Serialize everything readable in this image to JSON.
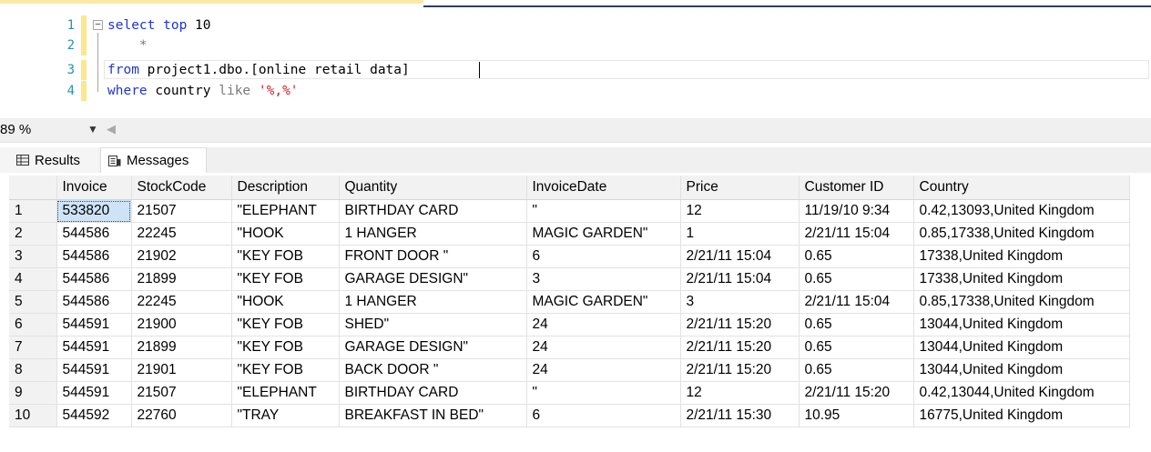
{
  "editor": {
    "lines": [
      {
        "number": "1",
        "segments": [
          {
            "text": "select top",
            "cls": "kw"
          },
          {
            "text": " 10",
            "cls": ""
          }
        ]
      },
      {
        "number": "2",
        "segments": [
          {
            "text": "    *",
            "cls": "gray"
          }
        ]
      },
      {
        "number": "3",
        "segments": [
          {
            "text": "from",
            "cls": "kw"
          },
          {
            "text": " project1.dbo.[online retail data]",
            "cls": ""
          }
        ]
      },
      {
        "number": "4",
        "segments": [
          {
            "text": "where",
            "cls": "kw"
          },
          {
            "text": " country ",
            "cls": ""
          },
          {
            "text": "like",
            "cls": "gray"
          },
          {
            "text": " ",
            "cls": ""
          },
          {
            "text": "'%,%'",
            "cls": "str"
          }
        ]
      }
    ]
  },
  "zoom": {
    "value": "89 %"
  },
  "tabs": {
    "results": "Results",
    "messages": "Messages"
  },
  "grid": {
    "columns": [
      "",
      "Invoice",
      "StockCode",
      "Description",
      "Quantity",
      "InvoiceDate",
      "Price",
      "Customer ID",
      "Country"
    ],
    "rows": [
      [
        "1",
        "533820",
        "21507",
        "\"ELEPHANT",
        "BIRTHDAY CARD",
        "\"",
        "12",
        "11/19/10 9:34",
        "0.42,13093,United Kingdom"
      ],
      [
        "2",
        "544586",
        "22245",
        "\"HOOK",
        "1 HANGER",
        "MAGIC GARDEN\"",
        "1",
        "2/21/11 15:04",
        "0.85,17338,United Kingdom"
      ],
      [
        "3",
        "544586",
        "21902",
        "\"KEY FOB",
        "FRONT  DOOR \"",
        "6",
        "2/21/11 15:04",
        "0.65",
        "17338,United Kingdom"
      ],
      [
        "4",
        "544586",
        "21899",
        "\"KEY FOB",
        "GARAGE DESIGN\"",
        "3",
        "2/21/11 15:04",
        "0.65",
        "17338,United Kingdom"
      ],
      [
        "5",
        "544586",
        "22245",
        "\"HOOK",
        "1 HANGER",
        "MAGIC GARDEN\"",
        "3",
        "2/21/11 15:04",
        "0.85,17338,United Kingdom"
      ],
      [
        "6",
        "544591",
        "21900",
        "\"KEY FOB",
        "SHED\"",
        "24",
        "2/21/11 15:20",
        "0.65",
        "13044,United Kingdom"
      ],
      [
        "7",
        "544591",
        "21899",
        "\"KEY FOB",
        "GARAGE DESIGN\"",
        "24",
        "2/21/11 15:20",
        "0.65",
        "13044,United Kingdom"
      ],
      [
        "8",
        "544591",
        "21901",
        "\"KEY FOB",
        "BACK DOOR \"",
        "24",
        "2/21/11 15:20",
        "0.65",
        "13044,United Kingdom"
      ],
      [
        "9",
        "544591",
        "21507",
        "\"ELEPHANT",
        "BIRTHDAY CARD",
        "\"",
        "12",
        "2/21/11 15:20",
        "0.42,13044,United Kingdom"
      ],
      [
        "10",
        "544592",
        "22760",
        "\"TRAY",
        "BREAKFAST IN BED\"",
        "6",
        "2/21/11 15:30",
        "10.95",
        "16775,United Kingdom"
      ]
    ]
  },
  "colors": {
    "keyword": "#1f34d6",
    "string": "#d3222a",
    "line_number": "#2b91af",
    "selection": "#cfe3f7"
  }
}
